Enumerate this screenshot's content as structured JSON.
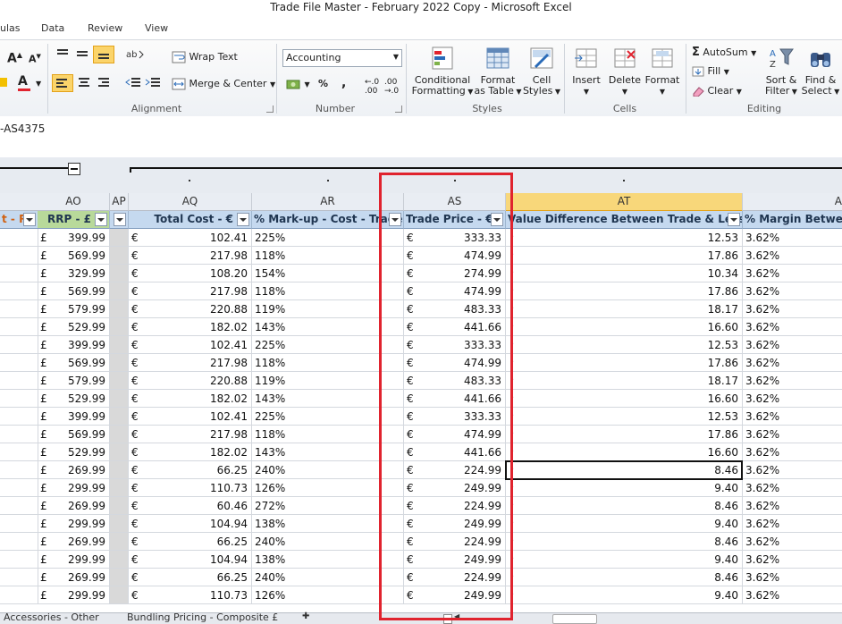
{
  "title": "Trade File Master - February 2022 Copy  -  Microsoft Excel",
  "ribbon_tabs": [
    "ulas",
    "Data",
    "Review",
    "View"
  ],
  "ribbon": {
    "wrap_text": "Wrap Text",
    "merge_center": "Merge & Center",
    "alignment_label": "Alignment",
    "number_format": "Accounting",
    "number_label": "Number",
    "percent": "%",
    "comma": ",",
    "conditional_formatting": [
      "Conditional",
      "Formatting"
    ],
    "format_as_table": [
      "Format",
      "as Table"
    ],
    "cell_styles": [
      "Cell",
      "Styles"
    ],
    "styles_label": "Styles",
    "insert": "Insert",
    "delete": "Delete",
    "format": "Format",
    "cells_label": "Cells",
    "autosum": "AutoSum",
    "fill": "Fill",
    "clear": "Clear",
    "sort_filter": [
      "Sort &",
      "Filter"
    ],
    "find_select": [
      "Find &",
      "Select"
    ],
    "editing_label": "Editing",
    "font_color_letter": "A"
  },
  "formula_bar": "-AS4375",
  "columns": {
    "AO": "AO",
    "AP": "AP",
    "AQ": "AQ",
    "AR": "AR",
    "AS": "AS",
    "AT": "AT",
    "AU": "A"
  },
  "headers": {
    "left": "t - R",
    "AO": "RRP - £",
    "AQ": "Total Cost - €",
    "AR": "% Mark-up - Cost - Trade",
    "AS": "Trade Price - €",
    "AT": "Value Difference Between Trade & Less",
    "AU": "% Margin Betwee"
  },
  "rows": [
    {
      "rrp": "399.99",
      "cost": "102.41",
      "markup": "225%",
      "trade": "333.33",
      "diff": "12.53",
      "margin": "3.62%"
    },
    {
      "rrp": "569.99",
      "cost": "217.98",
      "markup": "118%",
      "trade": "474.99",
      "diff": "17.86",
      "margin": "3.62%"
    },
    {
      "rrp": "329.99",
      "cost": "108.20",
      "markup": "154%",
      "trade": "274.99",
      "diff": "10.34",
      "margin": "3.62%"
    },
    {
      "rrp": "569.99",
      "cost": "217.98",
      "markup": "118%",
      "trade": "474.99",
      "diff": "17.86",
      "margin": "3.62%"
    },
    {
      "rrp": "579.99",
      "cost": "220.88",
      "markup": "119%",
      "trade": "483.33",
      "diff": "18.17",
      "margin": "3.62%"
    },
    {
      "rrp": "529.99",
      "cost": "182.02",
      "markup": "143%",
      "trade": "441.66",
      "diff": "16.60",
      "margin": "3.62%"
    },
    {
      "rrp": "399.99",
      "cost": "102.41",
      "markup": "225%",
      "trade": "333.33",
      "diff": "12.53",
      "margin": "3.62%"
    },
    {
      "rrp": "569.99",
      "cost": "217.98",
      "markup": "118%",
      "trade": "474.99",
      "diff": "17.86",
      "margin": "3.62%"
    },
    {
      "rrp": "579.99",
      "cost": "220.88",
      "markup": "119%",
      "trade": "483.33",
      "diff": "18.17",
      "margin": "3.62%"
    },
    {
      "rrp": "529.99",
      "cost": "182.02",
      "markup": "143%",
      "trade": "441.66",
      "diff": "16.60",
      "margin": "3.62%"
    },
    {
      "rrp": "399.99",
      "cost": "102.41",
      "markup": "225%",
      "trade": "333.33",
      "diff": "12.53",
      "margin": "3.62%"
    },
    {
      "rrp": "569.99",
      "cost": "217.98",
      "markup": "118%",
      "trade": "474.99",
      "diff": "17.86",
      "margin": "3.62%"
    },
    {
      "rrp": "529.99",
      "cost": "182.02",
      "markup": "143%",
      "trade": "441.66",
      "diff": "16.60",
      "margin": "3.62%"
    },
    {
      "rrp": "269.99",
      "cost": "66.25",
      "markup": "240%",
      "trade": "224.99",
      "diff": "8.46",
      "margin": "3.62%"
    },
    {
      "rrp": "299.99",
      "cost": "110.73",
      "markup": "126%",
      "trade": "249.99",
      "diff": "9.40",
      "margin": "3.62%"
    },
    {
      "rrp": "269.99",
      "cost": "60.46",
      "markup": "272%",
      "trade": "224.99",
      "diff": "8.46",
      "margin": "3.62%"
    },
    {
      "rrp": "299.99",
      "cost": "104.94",
      "markup": "138%",
      "trade": "249.99",
      "diff": "9.40",
      "margin": "3.62%"
    },
    {
      "rrp": "269.99",
      "cost": "66.25",
      "markup": "240%",
      "trade": "224.99",
      "diff": "8.46",
      "margin": "3.62%"
    },
    {
      "rrp": "299.99",
      "cost": "104.94",
      "markup": "138%",
      "trade": "249.99",
      "diff": "9.40",
      "margin": "3.62%"
    },
    {
      "rrp": "269.99",
      "cost": "66.25",
      "markup": "240%",
      "trade": "224.99",
      "diff": "8.46",
      "margin": "3.62%"
    },
    {
      "rrp": "299.99",
      "cost": "110.73",
      "markup": "126%",
      "trade": "249.99",
      "diff": "9.40",
      "margin": "3.62%"
    }
  ],
  "currency": {
    "gbp": "£",
    "eur": "€"
  },
  "sheet_tabs": [
    "Accessories - Other",
    "Bundling Pricing - Composite £"
  ],
  "colors": {
    "highlight": "#e0232e",
    "selected_col": "#f8d77a",
    "filter_header": "#c5d9ef"
  }
}
